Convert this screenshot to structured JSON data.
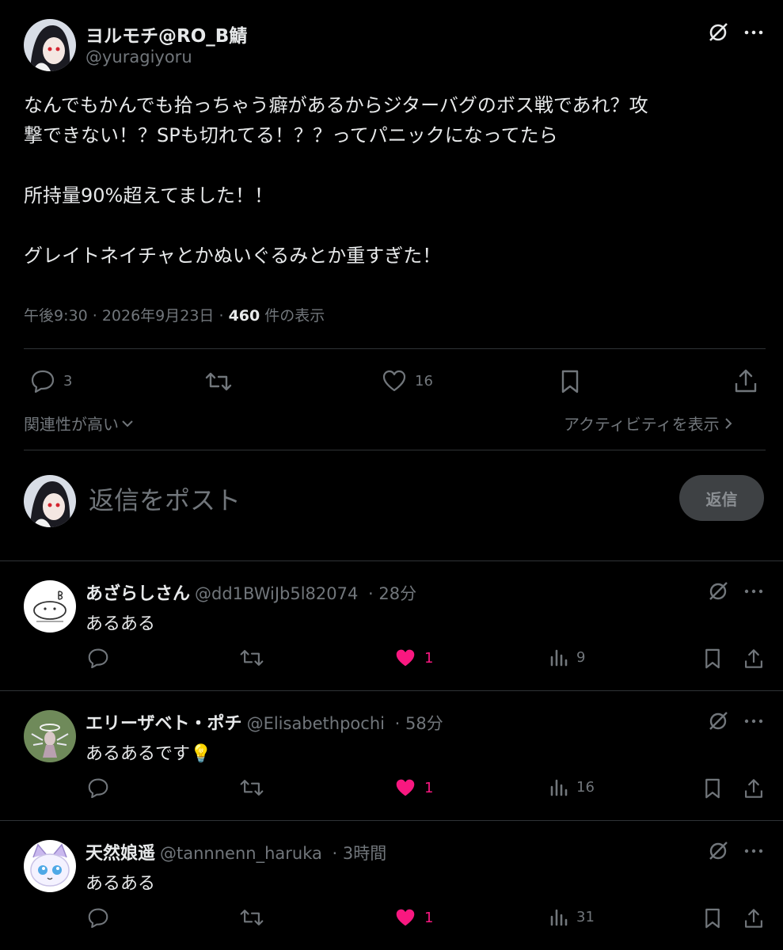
{
  "post": {
    "author_name": "ヨルモチ@RO_B鯖",
    "author_handle": "@yuragiyoru",
    "text_lines": [
      "なんでもかんでも拾っちゃう癖があるからジターバグのボス戦であれ？攻",
      "撃できない！？SPも切れてる！？？ってパニックになってたら",
      "",
      "所持量90%超えてました！！",
      "",
      "グレイトネイチャとかぬいぐるみとか重すぎた！"
    ],
    "time": "午後9:30",
    "date": "2026年9月23日",
    "views_count": "460",
    "views_label": "件の表示",
    "replies_count": "3",
    "likes_count": "16"
  },
  "sort": {
    "label": "関連性が高い",
    "activity_label": "アクティビティを表示"
  },
  "composer": {
    "placeholder": "返信をポスト",
    "reply_button": "返信"
  },
  "replies": [
    {
      "name": "あざらしさん",
      "handle": "@dd1BWiJb5l82074",
      "time": "28分",
      "text": "あるある",
      "likes": "1",
      "views": "9"
    },
    {
      "name": "エリーザベト・ポチ",
      "handle": "@Elisabethpochi",
      "time": "58分",
      "text": "あるあるです💡",
      "likes": "1",
      "views": "16"
    },
    {
      "name": "天然娘遥",
      "handle": "@tannnenn_haruka",
      "time": "3時間",
      "text": "あるある",
      "likes": "1",
      "views": "31"
    }
  ],
  "colors": {
    "background": "#000000",
    "text": "#e7e9ea",
    "muted": "#71767b",
    "divider": "#2f3336",
    "like": "#f91880"
  }
}
